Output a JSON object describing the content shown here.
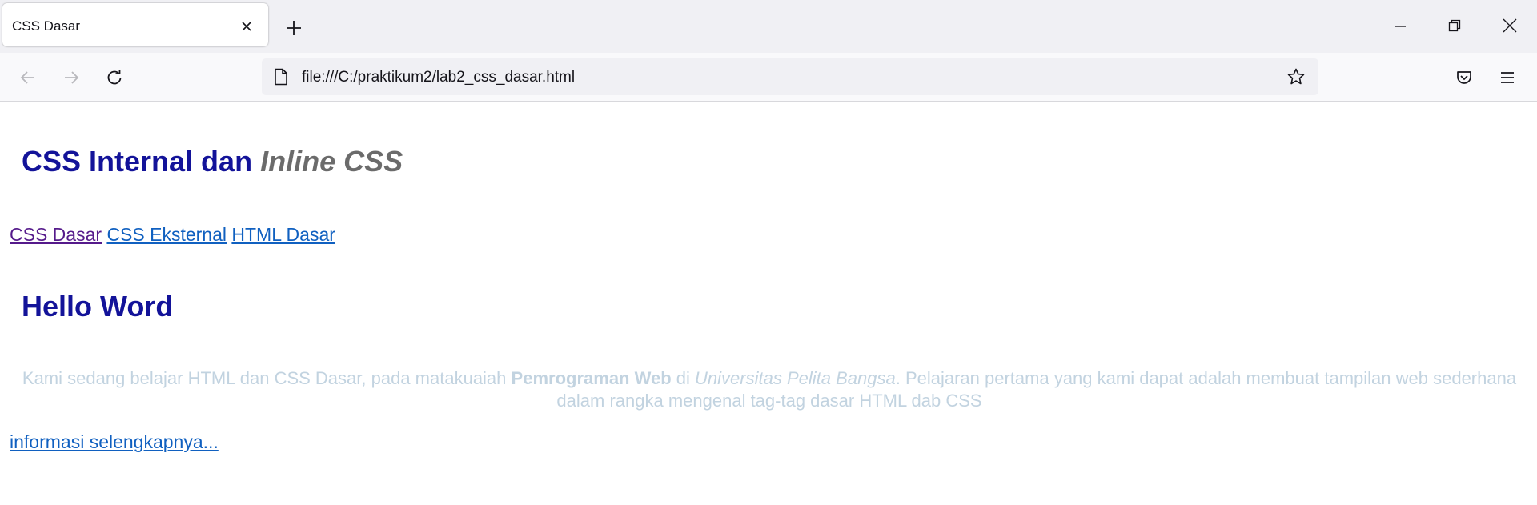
{
  "browser": {
    "tab": {
      "title": "CSS Dasar"
    },
    "url": "file:///C:/praktikum2/lab2_css_dasar.html"
  },
  "page": {
    "heading": {
      "plain": "CSS Internal dan",
      "italic": "Inline CSS"
    },
    "nav_links": [
      {
        "label": "CSS Dasar",
        "visited": true
      },
      {
        "label": "CSS Eksternal",
        "visited": false
      },
      {
        "label": "HTML Dasar",
        "visited": false
      }
    ],
    "subheading": "Hello Word",
    "paragraph": {
      "part1": "Kami sedang belajar HTML dan CSS Dasar, pada matakuaiah",
      "bold": "Pemrograman Web",
      "part2": "di",
      "italic": "Universitas Pelita Bangsa",
      "part3": ". Pelajaran pertama yang kami dapat adalah membuat tampilan web sederhana dalam rangka mengenal tag-tag dasar HTML dab CSS"
    },
    "more_link": "informasi selengkapnya..."
  },
  "colors": {
    "heading": "#131399",
    "italic_heading": "#6b6b6b",
    "link": "#1060c0",
    "visited_link": "#551a8b",
    "paragraph": "#c2d3e0",
    "rule": "#7fc9e0"
  },
  "icons": {
    "tab_close": "close-icon",
    "new_tab": "plus-icon",
    "minimize": "minimize-icon",
    "restore": "restore-icon",
    "close_window": "close-icon",
    "back": "arrow-left-icon",
    "forward": "arrow-right-icon",
    "reload": "reload-icon",
    "page": "page-icon",
    "bookmark": "star-icon",
    "pocket": "pocket-icon",
    "menu": "hamburger-menu-icon"
  }
}
